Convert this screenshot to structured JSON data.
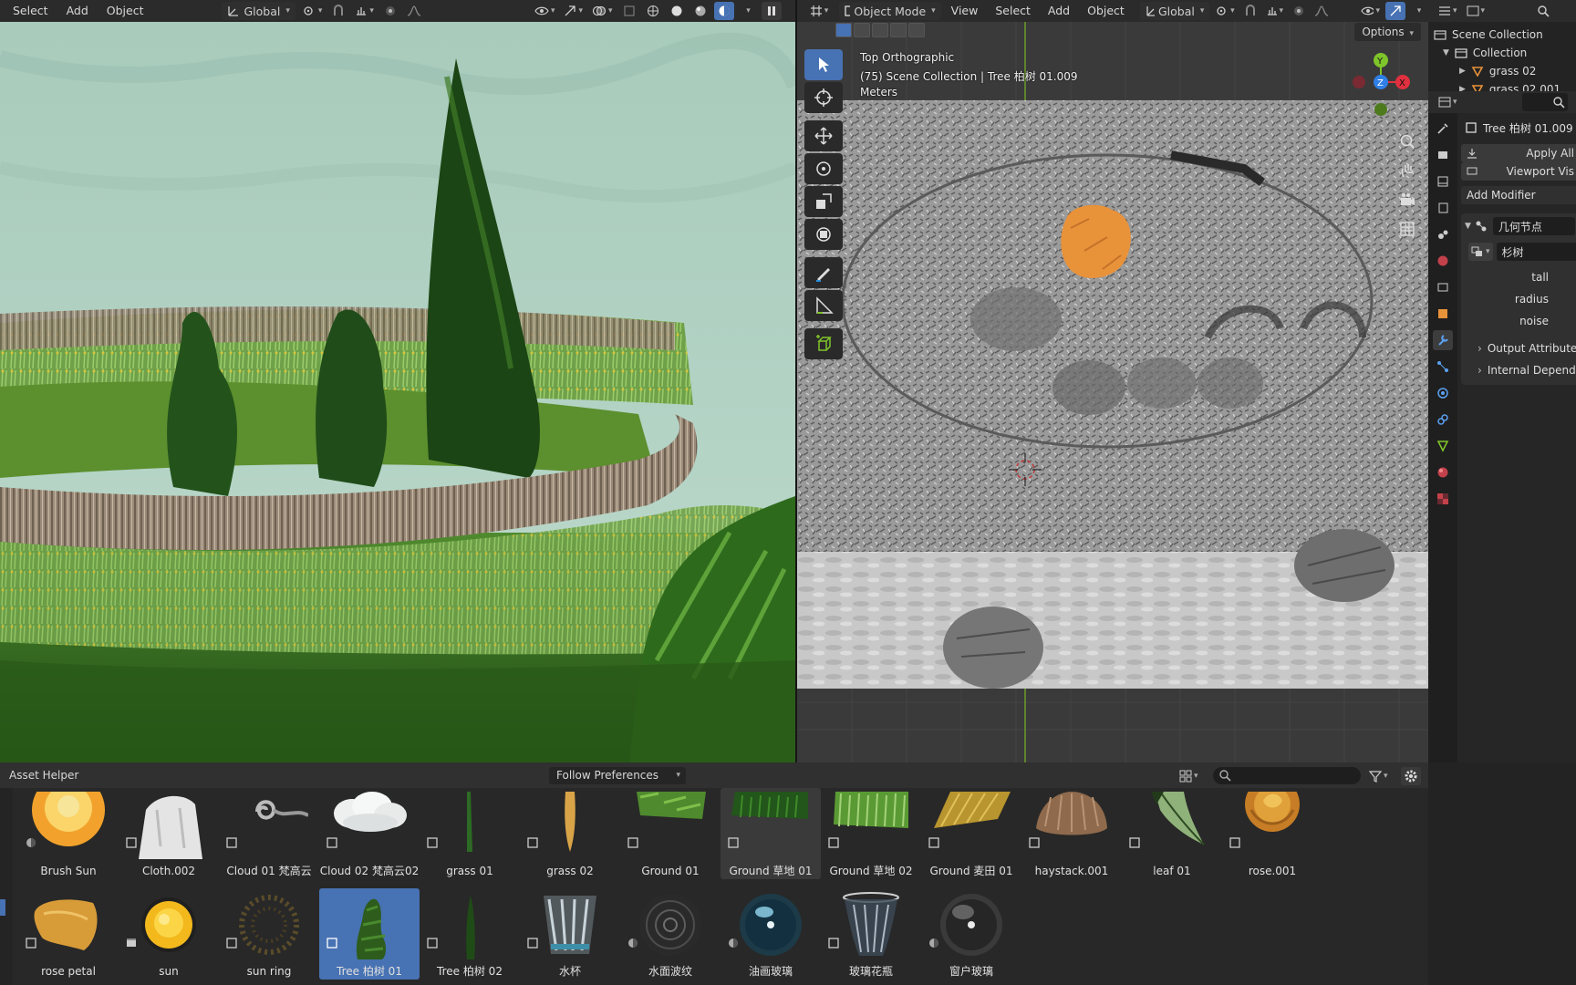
{
  "left_header": {
    "menus": [
      "Select",
      "Add",
      "Object"
    ],
    "transform_orientation": "Global"
  },
  "right_header": {
    "mode": "Object Mode",
    "menus": [
      "View",
      "Select",
      "Add",
      "Object"
    ],
    "transform_orientation": "Global",
    "options_label": "Options"
  },
  "viewport_overlay": {
    "view_name": "Top Orthographic",
    "collection_info": "(75) Scene Collection | Tree 柏树 01.009",
    "units": "Meters"
  },
  "gizmo": {
    "y": "Y",
    "z": "Z",
    "x": "X"
  },
  "outliner": {
    "scene_collection": "Scene Collection",
    "collection": "Collection",
    "items": [
      "grass 02",
      "grass 02.001"
    ]
  },
  "properties": {
    "object_name": "Tree 柏树 01.009",
    "apply_all": "Apply All",
    "viewport_vis": "Viewport Vis",
    "add_modifier": "Add Modifier",
    "modifier_name": "几何节点",
    "node_group": "杉树",
    "inputs": [
      "tall",
      "radius",
      "noise"
    ],
    "panels": [
      "Output Attribute",
      "Internal Depend"
    ]
  },
  "asset_browser": {
    "title": "Asset Helper",
    "library": "Follow Preferences",
    "row1": [
      {
        "label": "Brush Sun",
        "icon": "material-icon"
      },
      {
        "label": "Cloth.002",
        "icon": "object-icon"
      },
      {
        "label": "Cloud 01 梵高云",
        "icon": "object-icon"
      },
      {
        "label": "Cloud 02 梵高云02",
        "icon": "object-icon"
      },
      {
        "label": "grass 01",
        "icon": "object-icon"
      },
      {
        "label": "grass 02",
        "icon": "object-icon"
      },
      {
        "label": "Ground 01",
        "icon": "object-icon"
      },
      {
        "label": "Ground 草地 01",
        "icon": "object-icon"
      },
      {
        "label": "Ground 草地 02",
        "icon": "object-icon"
      },
      {
        "label": "Ground 麦田 01",
        "icon": "object-icon"
      },
      {
        "label": "haystack.001",
        "icon": "object-icon"
      },
      {
        "label": "leaf 01",
        "icon": "object-icon"
      },
      {
        "label": "rose.001",
        "icon": "object-icon"
      }
    ],
    "row2": [
      {
        "label": "rose petal",
        "icon": "object-icon"
      },
      {
        "label": "sun",
        "icon": "collection-icon"
      },
      {
        "label": "sun ring",
        "icon": "object-icon"
      },
      {
        "label": "Tree 柏树 01",
        "icon": "object-icon"
      },
      {
        "label": "Tree 柏树 02",
        "icon": "object-icon"
      },
      {
        "label": "水杯",
        "icon": "object-icon"
      },
      {
        "label": "水面波纹",
        "icon": "material-icon"
      },
      {
        "label": "油画玻璃",
        "icon": "material-icon"
      },
      {
        "label": "玻璃花瓶",
        "icon": "object-icon"
      },
      {
        "label": "窗户玻璃",
        "icon": "material-icon"
      }
    ]
  },
  "colors": {
    "accent": "#4772b3",
    "x_axis": "#e0303f",
    "y_axis": "#7fc42a",
    "z_axis": "#2f7fe6"
  }
}
